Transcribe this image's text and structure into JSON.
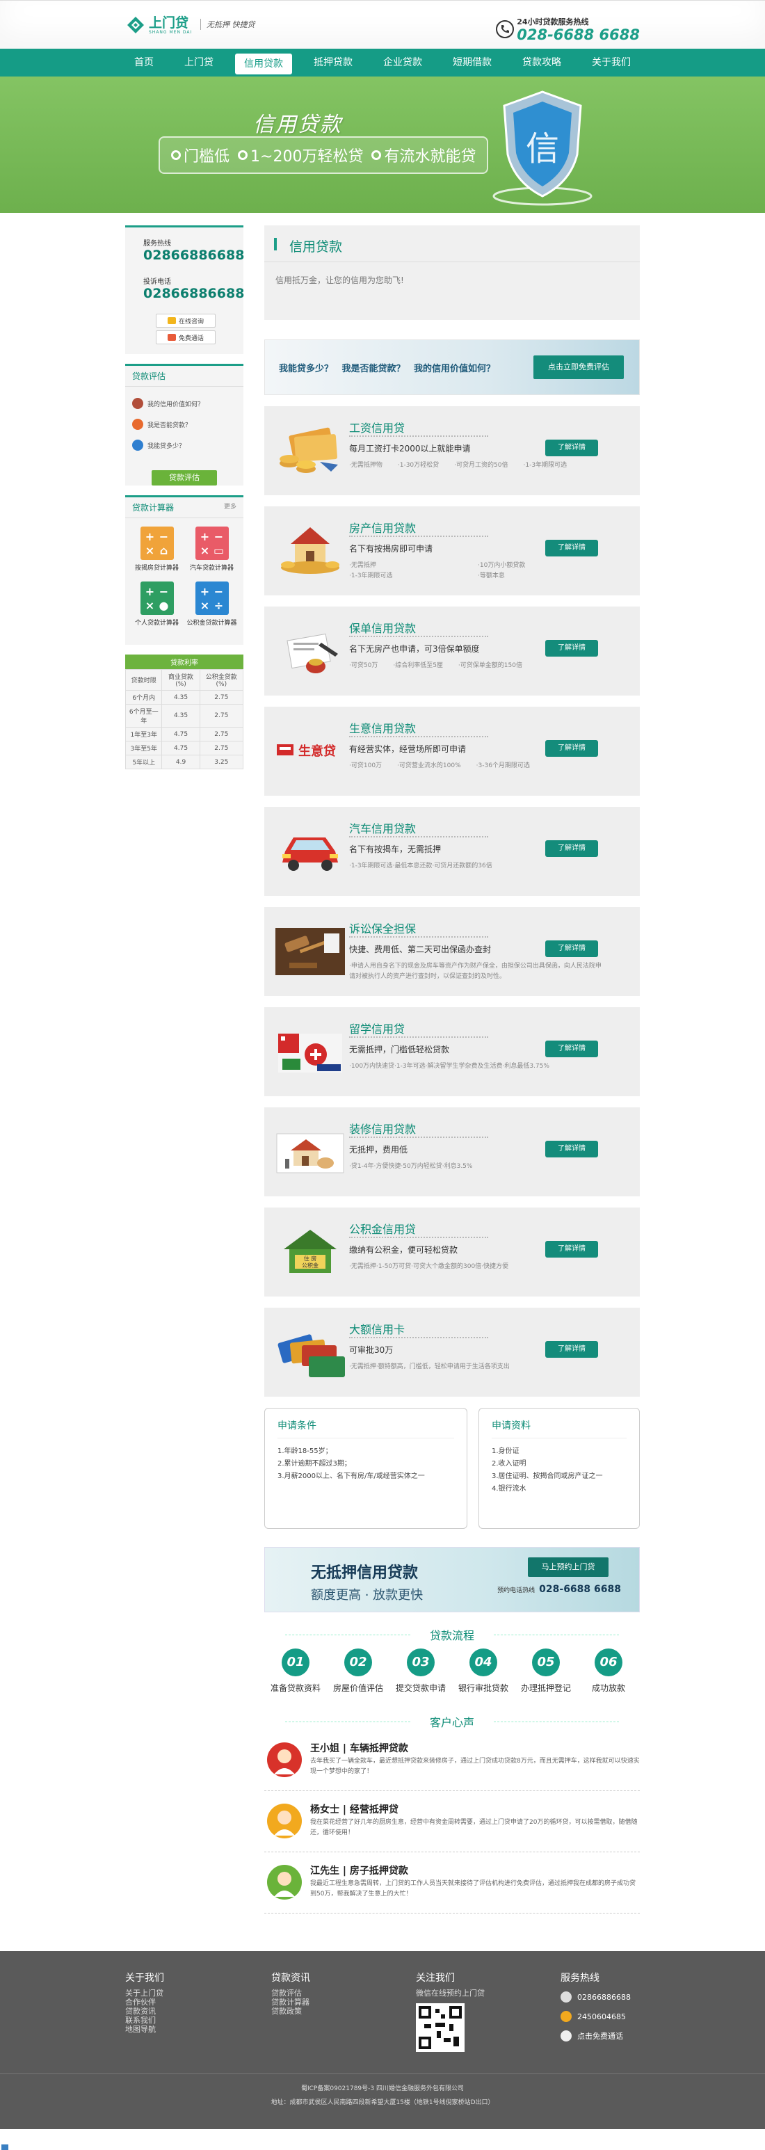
{
  "header": {
    "logo_cn": "上门贷",
    "logo_en": "SHANG MEN DAI",
    "slogan": "无抵押  快捷贷",
    "hotline_label": "24小时贷款服务热线",
    "hotline_number": "028-6688 6688"
  },
  "nav": [
    "首页",
    "上门贷",
    "信用贷款",
    "抵押贷款",
    "企业贷款",
    "短期借款",
    "贷款攻略",
    "关于我们"
  ],
  "nav_active": "信用贷款",
  "banner": {
    "title": "信用贷款",
    "items": [
      "门槛低",
      "1~200万轻松贷",
      "有流水就能贷"
    ],
    "shield_char": "信"
  },
  "sidebar": {
    "service_label": "服务热线",
    "service_number": "02866886688",
    "complaint_label": "投诉电话",
    "complaint_number": "02866886688",
    "buttons": [
      "在线咨询",
      "免费通话"
    ],
    "eval_title": "贷款评估",
    "eval_items": [
      "我的信用价值如何？",
      "我是否能贷款？",
      "我能贷多少？"
    ],
    "eval_button": "贷款评估",
    "calc_title": "贷款计算器",
    "calc_more": "更多",
    "calculators": [
      "按揭房贷计算器",
      "汽车贷款计算器",
      "个人贷款计算器",
      "公积金贷款计算器"
    ],
    "rate_title": "贷款利率",
    "rate_headers": [
      "贷款时限",
      "商业贷款(%)",
      "公积金贷款(%)"
    ],
    "rate_rows": [
      [
        "6个月内",
        "4.35",
        "2.75"
      ],
      [
        "6个月至一年",
        "4.35",
        "2.75"
      ],
      [
        "1年至3年",
        "4.75",
        "2.75"
      ],
      [
        "3年至5年",
        "4.75",
        "2.75"
      ],
      [
        "5年以上",
        "4.9",
        "3.25"
      ]
    ]
  },
  "intro": {
    "title": "信用贷款",
    "text": "信用抵万金，让您的信用为您助飞!"
  },
  "question_banner": {
    "text": "我能贷多少？  我是否能贷款？  我的信用价值如何？",
    "button": "点击立即免费评估"
  },
  "products": [
    {
      "name": "工资信用贷",
      "sub": "每月工资打卡2000以上就能申请",
      "features": [
        "·无需抵押物",
        "·1-30万轻松贷",
        "·可贷月工资的50倍",
        "·1-3年期限可选"
      ],
      "button": "了解详情"
    },
    {
      "name": "房产信用贷款",
      "sub": "名下有按揭房即可申请",
      "features": [
        "·无需抵押",
        "·10万内小额贷款",
        "·1-3年期限可选",
        "·等额本息"
      ],
      "button": "了解详情"
    },
    {
      "name": "保单信用贷款",
      "sub": "名下无房产也申请，可3倍保单额度",
      "features": [
        "·可贷50万",
        "·综合利率低至5厘",
        "·可贷保单金额的150倍"
      ],
      "button": "了解详情"
    },
    {
      "name": "生意信用贷款",
      "sub": "有经营实体，经营场所即可申请",
      "features": [
        "·可贷100万",
        "·可贷营业流水的100%",
        "·3-36个月期限可选"
      ],
      "button": "了解详情"
    },
    {
      "name": "汽车信用贷款",
      "sub": "名下有按揭车，无需抵押",
      "features": [
        "·1-3年期限可选·最低本息还款·可贷月还款额的36倍"
      ],
      "button": "了解详情"
    },
    {
      "name": "诉讼保全担保",
      "sub": "快捷、费用低、第二天可出保函办查封",
      "features": [
        "·申请人用自身名下的现金及房车等资产作为财产保全，由担保公司出具保函，向人民法院申请对被执行人的资产进行查封时，以保证查封的及时性。"
      ],
      "button": "了解详情"
    },
    {
      "name": "留学信用贷",
      "sub": "无需抵押，门槛低轻松贷款",
      "features": [
        "·100万内快速贷·1-3年可选·解决留学生学杂费及生活费·利息最低3.75%"
      ],
      "button": "了解详情"
    },
    {
      "name": "装修信用贷款",
      "sub": "无抵押，费用低",
      "features": [
        "·贷1-4年·方便快捷·50万内轻松贷·利息3.5%"
      ],
      "button": "了解详情"
    },
    {
      "name": "公积金信用贷",
      "sub": "缴纳有公积金，便可轻松贷款",
      "features": [
        "·无需抵押·1-50万可贷·可贷大个缴金额的300倍·快捷方便"
      ],
      "button": "了解详情"
    },
    {
      "name": "大额信用卡",
      "sub": "可审批30万",
      "features": [
        "·无需抵押·额特额高，门槛低，轻松申请用于生活各项支出"
      ],
      "button": "了解详情"
    }
  ],
  "apply": {
    "conditions_title": "申请条件",
    "conditions": [
      "1.年龄18-55岁；",
      "2.累计逾期不超过3期；",
      "3.月薪2000以上、名下有房/车/或经营实体之一"
    ],
    "materials_title": "申请资料",
    "materials": [
      "1.身份证",
      "2.收入证明",
      "3.居住证明、按揭合同或房产证之一",
      "4.银行流水"
    ]
  },
  "ad": {
    "title": "无抵押信用贷款",
    "subtitle": "额度更高 · 放款更快",
    "button": "马上预约上门贷",
    "hotline_label": "预约电话热线",
    "hotline_number": "028-6688 6688"
  },
  "process": {
    "title": "贷款流程",
    "steps": [
      {
        "num": "01",
        "label": "准备贷款资料"
      },
      {
        "num": "02",
        "label": "房屋价值评估"
      },
      {
        "num": "03",
        "label": "提交贷款申请"
      },
      {
        "num": "04",
        "label": "银行审批贷款"
      },
      {
        "num": "05",
        "label": "办理抵押登记"
      },
      {
        "num": "06",
        "label": "成功放款"
      }
    ]
  },
  "testimonials": {
    "title": "客户心声",
    "items": [
      {
        "name": "王小姐 | 车辆抵押贷款",
        "text": "去年我买了一辆全款车，最近想抵押贷款来装修房子，通过上门贷成功贷款8万元，而且无需押车，这样我就可以快速实现一个梦想中的家了！"
      },
      {
        "name": "杨女士 | 经营抵押贷",
        "text": "我在菜花经营了好几年的厨房生意，经营中有资金周转需要，通过上门贷申请了20万的循环贷，可以按需借取，随借随还，循环使用！"
      },
      {
        "name": "江先生 | 房子抵押贷款",
        "text": "我最近工程生意急需周转，上门贷的工作人员当天就来接待了评估机构进行免费评估，通过抵押我在成都的房子成功贷到50万，帮我解决了生意上的大忙！"
      }
    ]
  },
  "footer": {
    "about_title": "关于我们",
    "about_links": [
      "关于上门贷",
      "合作伙伴",
      "贷款资讯",
      "联系我们",
      "地图导航"
    ],
    "info_title": "贷款资讯",
    "info_links": [
      "贷款评估",
      "贷款计算器",
      "贷款政策"
    ],
    "follow_title": "关注我们",
    "follow_text": "微信在线预约上门贷",
    "service_title": "服务热线",
    "service_phone": "02866886688",
    "service_qq": "2450604685",
    "service_online": "点击免费通话",
    "icp": "蜀ICP备案09021789号-3   四川婚信金融服务外包有限公司",
    "address": "地址：成都市武侯区人民南路四段新希望大厦15楼（地铁1号线倪家桥站D出口）"
  },
  "colors": {
    "brand": "#159c86",
    "banner": "#78bb58",
    "footer": "#5a5a5a"
  }
}
